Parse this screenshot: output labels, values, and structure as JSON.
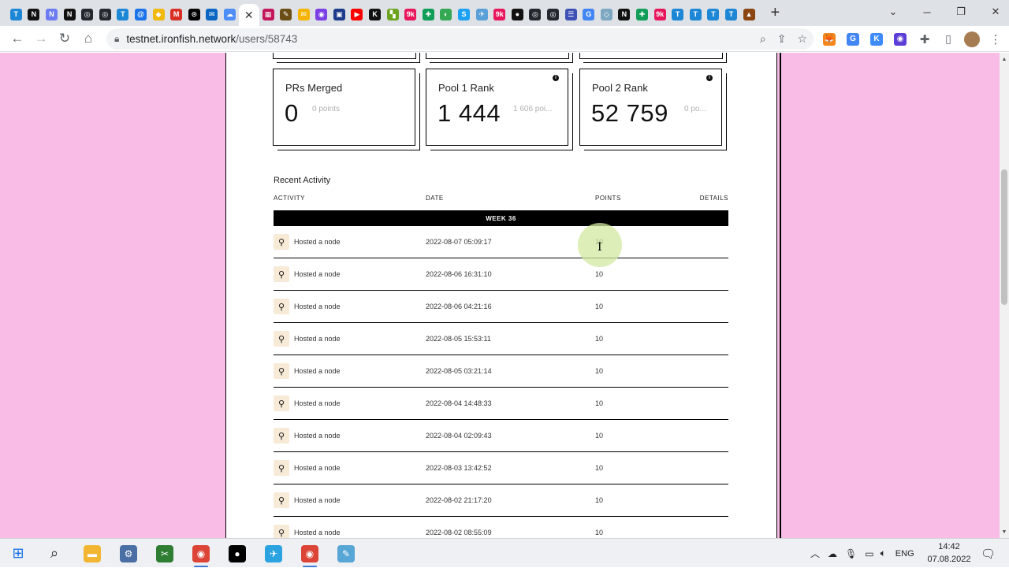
{
  "browser": {
    "tabs": [
      {
        "icon": "T",
        "color": "#1d87d6"
      },
      {
        "icon": "N",
        "color": "#111111"
      },
      {
        "icon": "N",
        "color": "#6d7cf2"
      },
      {
        "icon": "N",
        "color": "#111111"
      },
      {
        "icon": "◎",
        "color": "#24292f"
      },
      {
        "icon": "◎",
        "color": "#24292f"
      },
      {
        "icon": "T",
        "color": "#1d87d6"
      },
      {
        "icon": "@",
        "color": "#1a73e8"
      },
      {
        "icon": "◆",
        "color": "#f0b90b"
      },
      {
        "icon": "M",
        "color": "#d93025"
      },
      {
        "icon": "⊙",
        "color": "#000000"
      },
      {
        "icon": "✉",
        "color": "#0a66c2"
      },
      {
        "icon": "☁",
        "color": "#4f8ef7"
      },
      {
        "icon": "✕",
        "color": "#ffffff",
        "active": true
      },
      {
        "icon": "▦",
        "color": "#c2185b"
      },
      {
        "icon": "✎",
        "color": "#6b4e16"
      },
      {
        "icon": "✉",
        "color": "#f4b400"
      },
      {
        "icon": "◉",
        "color": "#7b3fe4"
      },
      {
        "icon": "▣",
        "color": "#1e3a8a"
      },
      {
        "icon": "▶",
        "color": "#ff0000"
      },
      {
        "icon": "K",
        "color": "#111111"
      },
      {
        "icon": "▚",
        "color": "#6ca31f"
      },
      {
        "icon": "9k",
        "color": "#e8175d"
      },
      {
        "icon": "✚",
        "color": "#0f9d58"
      },
      {
        "icon": "◐",
        "color": "#34a853"
      },
      {
        "icon": "S",
        "color": "#1da1f2"
      },
      {
        "icon": "✈",
        "color": "#5aa0d8"
      },
      {
        "icon": "9k",
        "color": "#e8175d"
      },
      {
        "icon": "●",
        "color": "#111111"
      },
      {
        "icon": "◎",
        "color": "#24292f"
      },
      {
        "icon": "◎",
        "color": "#24292f"
      },
      {
        "icon": "☰",
        "color": "#3f51b5"
      },
      {
        "icon": "G",
        "color": "#4285f4"
      },
      {
        "icon": "◇",
        "color": "#7ea7c2"
      },
      {
        "icon": "N",
        "color": "#111111"
      },
      {
        "icon": "✚",
        "color": "#0f9d58"
      },
      {
        "icon": "9k",
        "color": "#e8175d"
      },
      {
        "icon": "T",
        "color": "#1d87d6"
      },
      {
        "icon": "T",
        "color": "#1d87d6"
      },
      {
        "icon": "T",
        "color": "#1d87d6"
      },
      {
        "icon": "T",
        "color": "#1d87d6"
      },
      {
        "icon": "▲",
        "color": "#8b4513"
      }
    ],
    "url_host": "testnet.ironfish.network",
    "url_path": "/users/58743",
    "new_tab": "+",
    "extensions": [
      {
        "name": "metamask-extension-icon",
        "glyph": "🦊",
        "color": "#f6851b"
      },
      {
        "name": "translate-extension-icon",
        "glyph": "G",
        "color": "#4285f4"
      },
      {
        "name": "keplr-extension-icon",
        "glyph": "K",
        "color": "#3d8bfd"
      },
      {
        "name": "circle-extension-icon",
        "glyph": "◉",
        "color": "#5b3fd6"
      }
    ]
  },
  "page": {
    "cards": [
      {
        "title": "PRs Merged",
        "value": "0",
        "points": "0 points",
        "info": false
      },
      {
        "title": "Pool 1 Rank",
        "value": "1 444",
        "points": "1 606 poi...",
        "info": true
      },
      {
        "title": "Pool 2 Rank",
        "value": "52 759",
        "points": "0 po...",
        "info": true
      }
    ],
    "section_title": "Recent Activity",
    "columns": {
      "activity": "ACTIVITY",
      "date": "DATE",
      "points": "POINTS",
      "details": "DETAILS"
    },
    "week_label": "WEEK 36",
    "rows": [
      {
        "activity": "Hosted a node",
        "date": "2022-08-07 05:09:17",
        "points": "10"
      },
      {
        "activity": "Hosted a node",
        "date": "2022-08-06 16:31:10",
        "points": "10"
      },
      {
        "activity": "Hosted a node",
        "date": "2022-08-06 04:21:16",
        "points": "10"
      },
      {
        "activity": "Hosted a node",
        "date": "2022-08-05 15:53:11",
        "points": "10"
      },
      {
        "activity": "Hosted a node",
        "date": "2022-08-05 03:21:14",
        "points": "10"
      },
      {
        "activity": "Hosted a node",
        "date": "2022-08-04 14:48:33",
        "points": "10"
      },
      {
        "activity": "Hosted a node",
        "date": "2022-08-04 02:09:43",
        "points": "10"
      },
      {
        "activity": "Hosted a node",
        "date": "2022-08-03 13:42:52",
        "points": "10"
      },
      {
        "activity": "Hosted a node",
        "date": "2022-08-02 21:17:20",
        "points": "10"
      },
      {
        "activity": "Hosted a node",
        "date": "2022-08-02 08:55:09",
        "points": "10"
      }
    ],
    "colors": {
      "background": "#f9bce6",
      "week_bar": "#000000",
      "activity_icon_bg": "#f7ead6"
    }
  },
  "taskbar": {
    "apps": [
      {
        "name": "file-explorer",
        "glyph": "▬",
        "color": "#f2b632"
      },
      {
        "name": "network-app",
        "glyph": "⚙",
        "color": "#4a6fa5"
      },
      {
        "name": "snipping-app",
        "glyph": "✂",
        "color": "#2e7d32"
      },
      {
        "name": "chrome-profile-1",
        "glyph": "◉",
        "color": "#db4437"
      },
      {
        "name": "recorder",
        "glyph": "●",
        "color": "#000000"
      },
      {
        "name": "telegram",
        "glyph": "✈",
        "color": "#2aa3e0"
      },
      {
        "name": "chrome-profile-2",
        "glyph": "◉",
        "color": "#db4437"
      },
      {
        "name": "notepad-app",
        "glyph": "✎",
        "color": "#58a6d6"
      }
    ],
    "language": "ENG",
    "time": "14:42",
    "date": "07.08.2022"
  }
}
